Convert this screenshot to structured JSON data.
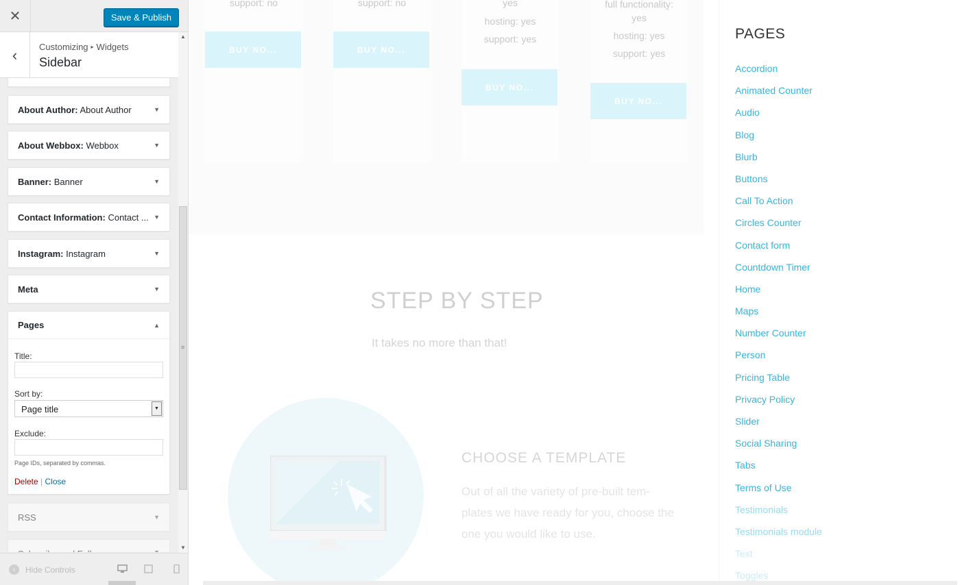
{
  "header": {
    "close_icon": "close-icon",
    "publish_label": "Save & Publish"
  },
  "section": {
    "breadcrumb_root": "Customizing",
    "breadcrumb_child": "Widgets",
    "title": "Sidebar"
  },
  "widgets": [
    {
      "type": "About Author:",
      "name": "About Author"
    },
    {
      "type": "About Webbox:",
      "name": "Webbox"
    },
    {
      "type": "Banner:",
      "name": "Banner"
    },
    {
      "type": "Contact Information:",
      "name": "Contact ..."
    },
    {
      "type": "Instagram:",
      "name": "Instagram"
    },
    {
      "type": "Meta",
      "name": ""
    },
    {
      "type": "Pages",
      "name": ""
    },
    {
      "type": "RSS",
      "name": ""
    },
    {
      "type": "Subscribe and Follow",
      "name": ""
    }
  ],
  "pages_form": {
    "title_label": "Title:",
    "title_value": "",
    "sort_label": "Sort by:",
    "sort_value": "Page title",
    "exclude_label": "Exclude:",
    "exclude_value": "",
    "hint": "Page IDs, separated by commas.",
    "delete_label": "Delete",
    "separator": "|",
    "close_label": "Close"
  },
  "footer": {
    "hide_controls": "Hide Controls"
  },
  "preview": {
    "pricing": {
      "col1": [
        "support: no"
      ],
      "col2": [
        "support: no"
      ],
      "col3": [
        "yes",
        "hosting: yes",
        "support: yes"
      ],
      "col4": [
        "full functionality:",
        "yes",
        "hosting: yes",
        "support: yes"
      ],
      "buy_label": "BUY NO..."
    },
    "step_title": "STEP BY STEP",
    "step_subtitle": "It takes no more than that!",
    "choose_title": "CHOOSE A TEMPLATE",
    "choose_text": "Out of all the variety of pre-built tem-plates we have ready for you, choose the one you would like to use.",
    "sidebar_title": "PAGES",
    "pages": [
      "Accordion",
      "Animated Counter",
      "Audio",
      "Blog",
      "Blurb",
      "Buttons",
      "Call To Action",
      "Circles Counter",
      "Contact form",
      "Countdown Timer",
      "Home",
      "Maps",
      "Number Counter",
      "Person",
      "Pricing Table",
      "Privacy Policy",
      "Slider",
      "Social Sharing",
      "Tabs",
      "Terms of Use",
      "Testimonials",
      "Testimonials module",
      "Text",
      "Toggles"
    ]
  },
  "colors": {
    "accent": "#0085ba",
    "link": "#35b6e0",
    "delete": "#a00000"
  }
}
